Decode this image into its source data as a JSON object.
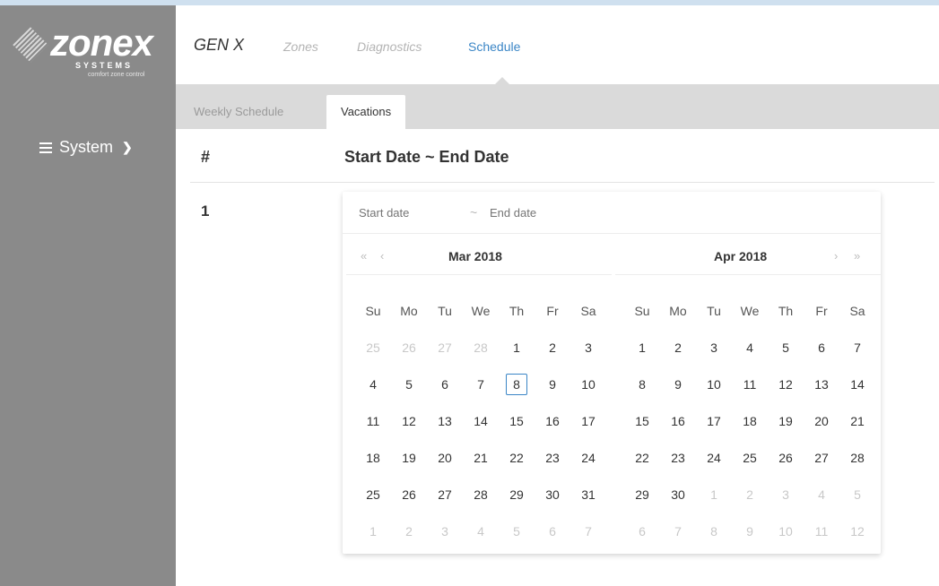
{
  "logo": {
    "word": "zonex",
    "sub": "SYSTEMS",
    "tag": "comfort zone control"
  },
  "sidebar": {
    "system_label": "System"
  },
  "nav": {
    "brand": "GEN X",
    "items": [
      "Zones",
      "Diagnostics",
      "Schedule"
    ],
    "active_index": 2
  },
  "tabs": [
    "Weekly Schedule",
    "Vacations"
  ],
  "table": {
    "col_num": "#",
    "col_dates": "Start Date ~ End Date",
    "row_number": "1"
  },
  "picker": {
    "start_placeholder": "Start date",
    "end_placeholder": "End date",
    "separator": "~",
    "weekdays": [
      "Su",
      "Mo",
      "Tu",
      "We",
      "Th",
      "Fr",
      "Sa"
    ],
    "left": {
      "title": "Mar 2018",
      "today": 8,
      "cells": [
        25,
        26,
        27,
        28,
        1,
        2,
        3,
        4,
        5,
        6,
        7,
        8,
        9,
        10,
        11,
        12,
        13,
        14,
        15,
        16,
        17,
        18,
        19,
        20,
        21,
        22,
        23,
        24,
        25,
        26,
        27,
        28,
        29,
        30,
        31,
        1,
        2,
        3,
        4,
        5,
        6,
        7
      ],
      "off_before": 4,
      "off_after": 7
    },
    "right": {
      "title": "Apr 2018",
      "cells": [
        1,
        2,
        3,
        4,
        5,
        6,
        7,
        8,
        9,
        10,
        11,
        12,
        13,
        14,
        15,
        16,
        17,
        18,
        19,
        20,
        21,
        22,
        23,
        24,
        25,
        26,
        27,
        28,
        29,
        30,
        1,
        2,
        3,
        4,
        5,
        6,
        7,
        8,
        9,
        10,
        11,
        12
      ],
      "off_before": 0,
      "off_after": 12
    },
    "nav": {
      "prev_year": "«",
      "prev_month": "‹",
      "next_month": "›",
      "next_year": "»"
    }
  },
  "colors": {
    "accent": "#3b86c6",
    "sidebar": "#8a8a8a",
    "tabbar": "#dadada"
  }
}
